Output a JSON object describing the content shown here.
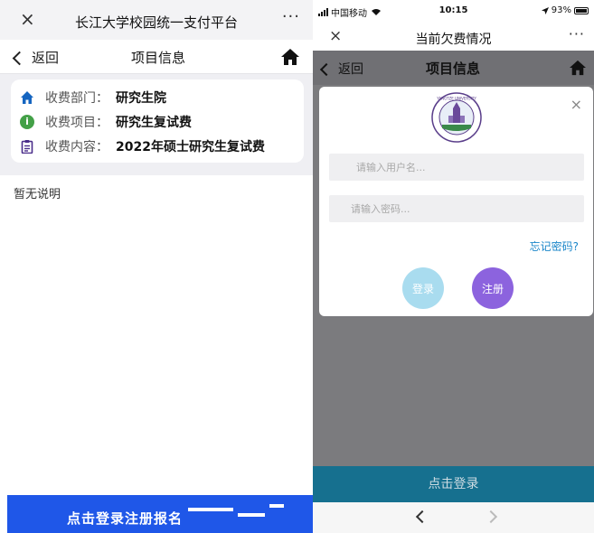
{
  "left": {
    "top_bar": {
      "close": "×",
      "title": "长江大学校园统一支付平台",
      "more": "···"
    },
    "nav": {
      "back_label": "返回",
      "title": "项目信息"
    },
    "info": [
      {
        "icon": "home-icon",
        "key": "收费部门：",
        "value": "研究生院"
      },
      {
        "icon": "info-icon",
        "key": "收费项目：",
        "value": "研究生复试费"
      },
      {
        "icon": "clipboard-icon",
        "key": "收费内容：",
        "value": "2022年硕士研究生复试费"
      }
    ],
    "description": "暂无说明",
    "bottom_button": "点击登录注册报名"
  },
  "right": {
    "status": {
      "carrier": "中国移动",
      "time": "10:15",
      "battery": "93%"
    },
    "top_bar": {
      "close": "×",
      "title": "当前欠费情况",
      "more": "···"
    },
    "nav": {
      "back_label": "返回",
      "title": "项目信息"
    },
    "modal": {
      "close": "×",
      "username_placeholder": "请输入用户名...",
      "password_placeholder": "请输入密码...",
      "forgot": "忘记密码?",
      "login": "登录",
      "register": "注册"
    },
    "bottom_button": "点击登录"
  },
  "colors": {
    "accent_blue": "#1f57e8",
    "teal": "#16708f",
    "purple": "#8c63de",
    "light_blue": "#a9dcef",
    "link": "#1a86c9"
  }
}
